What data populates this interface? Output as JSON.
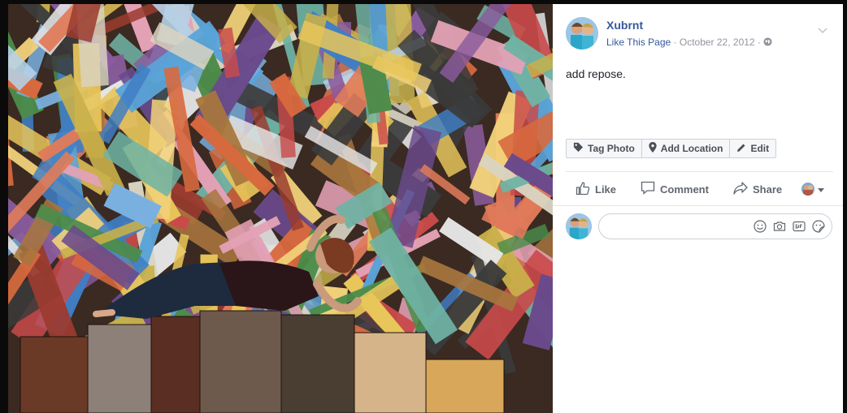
{
  "post": {
    "page_name": "Xubrnt",
    "like_page_label": "Like This Page",
    "separator": "·",
    "date": "October 22, 2012",
    "caption": "add repose."
  },
  "photo_actions": {
    "tag_photo": "Tag Photo",
    "add_location": "Add Location",
    "edit": "Edit"
  },
  "reactions": {
    "like": "Like",
    "comment": "Comment",
    "share": "Share"
  },
  "comment": {
    "placeholder": ""
  },
  "icons": {
    "audience": "globe-icon",
    "menu": "chevron-down-icon",
    "tag": "tag-icon",
    "location": "location-pin-icon",
    "edit": "pencil-icon",
    "like": "thumbs-up-icon",
    "comment": "speech-bubble-icon",
    "share": "share-arrow-icon",
    "emoji": "smiley-icon",
    "camera": "camera-icon",
    "gif": "gif-icon",
    "sticker": "sticker-icon"
  },
  "colors": {
    "link": "#365899",
    "meta": "#90949c",
    "text": "#1d2129",
    "action_text": "#606770"
  }
}
